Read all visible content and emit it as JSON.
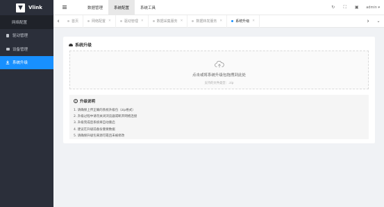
{
  "brand": {
    "name": "Vlink"
  },
  "sidebar": {
    "items": [
      {
        "label": "网络配置"
      },
      {
        "label": "驱动管理"
      },
      {
        "label": "设备管理"
      },
      {
        "label": "系统升级"
      }
    ]
  },
  "header": {
    "menu": [
      {
        "label": "数据管理"
      },
      {
        "label": "系统配置"
      },
      {
        "label": "系统工具"
      }
    ],
    "user": "admin ▾"
  },
  "tabs": [
    {
      "label": "首页"
    },
    {
      "label": "网络配置"
    },
    {
      "label": "驱动管理"
    },
    {
      "label": "数据采集服务"
    },
    {
      "label": "数据转发服务"
    },
    {
      "label": "系统升级"
    }
  ],
  "card": {
    "title": "系统升级",
    "upload_text": "点击或将系统升级包拖拽到此处",
    "upload_hint": "支持的文件类型：.zip",
    "notes_title": "升级说明",
    "notes": [
      "1. 请确保上传正确的系统升级包（zip格式）",
      "2. 升级过程中请勿关闭浏览器或断开网络连接",
      "3. 升级完成后系统将自动重启",
      "4. 建议在升级前备份重要数据",
      "5. 请确保升级包来源可靠且未被修改"
    ]
  },
  "colors": {
    "sidebar": "#2b2f3a",
    "accent": "#1890ff"
  }
}
